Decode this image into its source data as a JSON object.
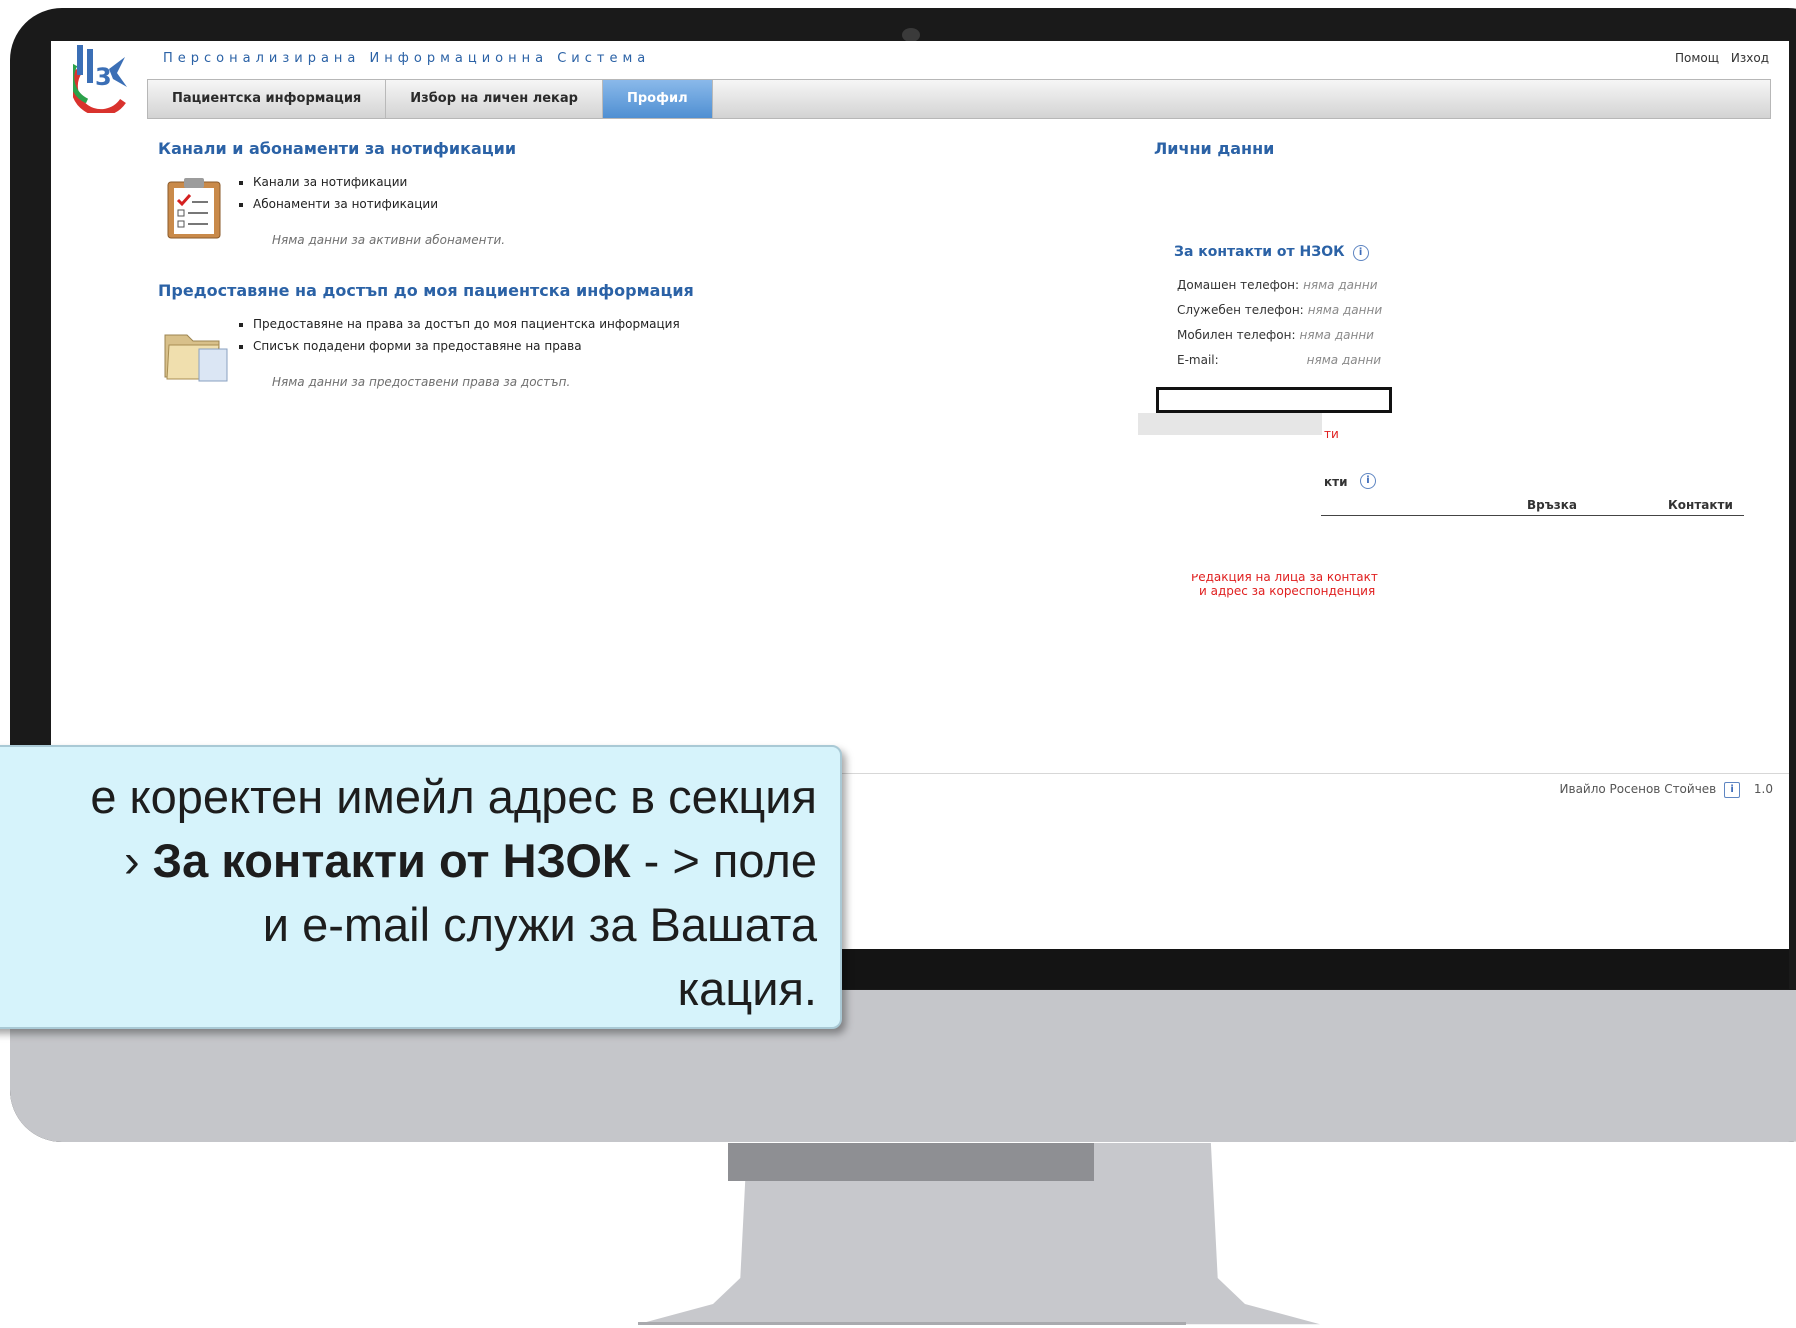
{
  "header": {
    "system_title": "Персонализирана Информационна Система",
    "help": "Помощ",
    "logout": "Изход"
  },
  "nav": {
    "tabs": [
      {
        "label": "Пациентска информация"
      },
      {
        "label": "Избор на личен лекар"
      },
      {
        "label": "Профил",
        "active": true
      }
    ]
  },
  "notifications": {
    "title": "Канали и абонаменти за нотификации",
    "items": [
      "Канали за нотификации",
      "Абонаменти за нотификации"
    ],
    "empty_note": "Няма данни за активни абонаменти."
  },
  "access": {
    "title": "Предоставяне на достъп до моя пациентска информация",
    "items": [
      "Предоставяне на права за достъп до моя пациентска информация",
      "Списък подадени форми за предоставяне на права"
    ],
    "empty_note": "Няма данни за предоставени права за достъп."
  },
  "personal": {
    "title": "Лични данни",
    "contacts_title": "За контакти от НЗОК",
    "home_phone_label": "Домашен телефон:",
    "home_phone_value": "няма данни",
    "work_phone_label": "Служебен телефон:",
    "work_phone_value": "няма данни",
    "mobile_label": "Мобилен телефон:",
    "mobile_value": "няма данни",
    "email_label": "E-mail:",
    "email_value": "няма данни",
    "red_fragment": "ти",
    "contacts_fragment": "кти",
    "col_relation": "Връзка",
    "col_contacts": "Контакти",
    "edit_link_line1": "Редакция на лица за контакт",
    "edit_link_line2": "и адрес за кореспонденция"
  },
  "footer": {
    "user": "Ивайло Росенов Стойчев",
    "version": "1.0"
  },
  "callout": {
    "line1": "е коректен имейл адрес в секция",
    "line2_pre": "› ",
    "line2_bold": "За контакти от НЗОК",
    "line2_post": " - > поле",
    "line3": "и e-mail служи за Вашата",
    "line4": "кация."
  },
  "colors": {
    "accent": "#2b62a6",
    "link_red": "#e02020",
    "callout_bg": "#d6f3fb"
  }
}
